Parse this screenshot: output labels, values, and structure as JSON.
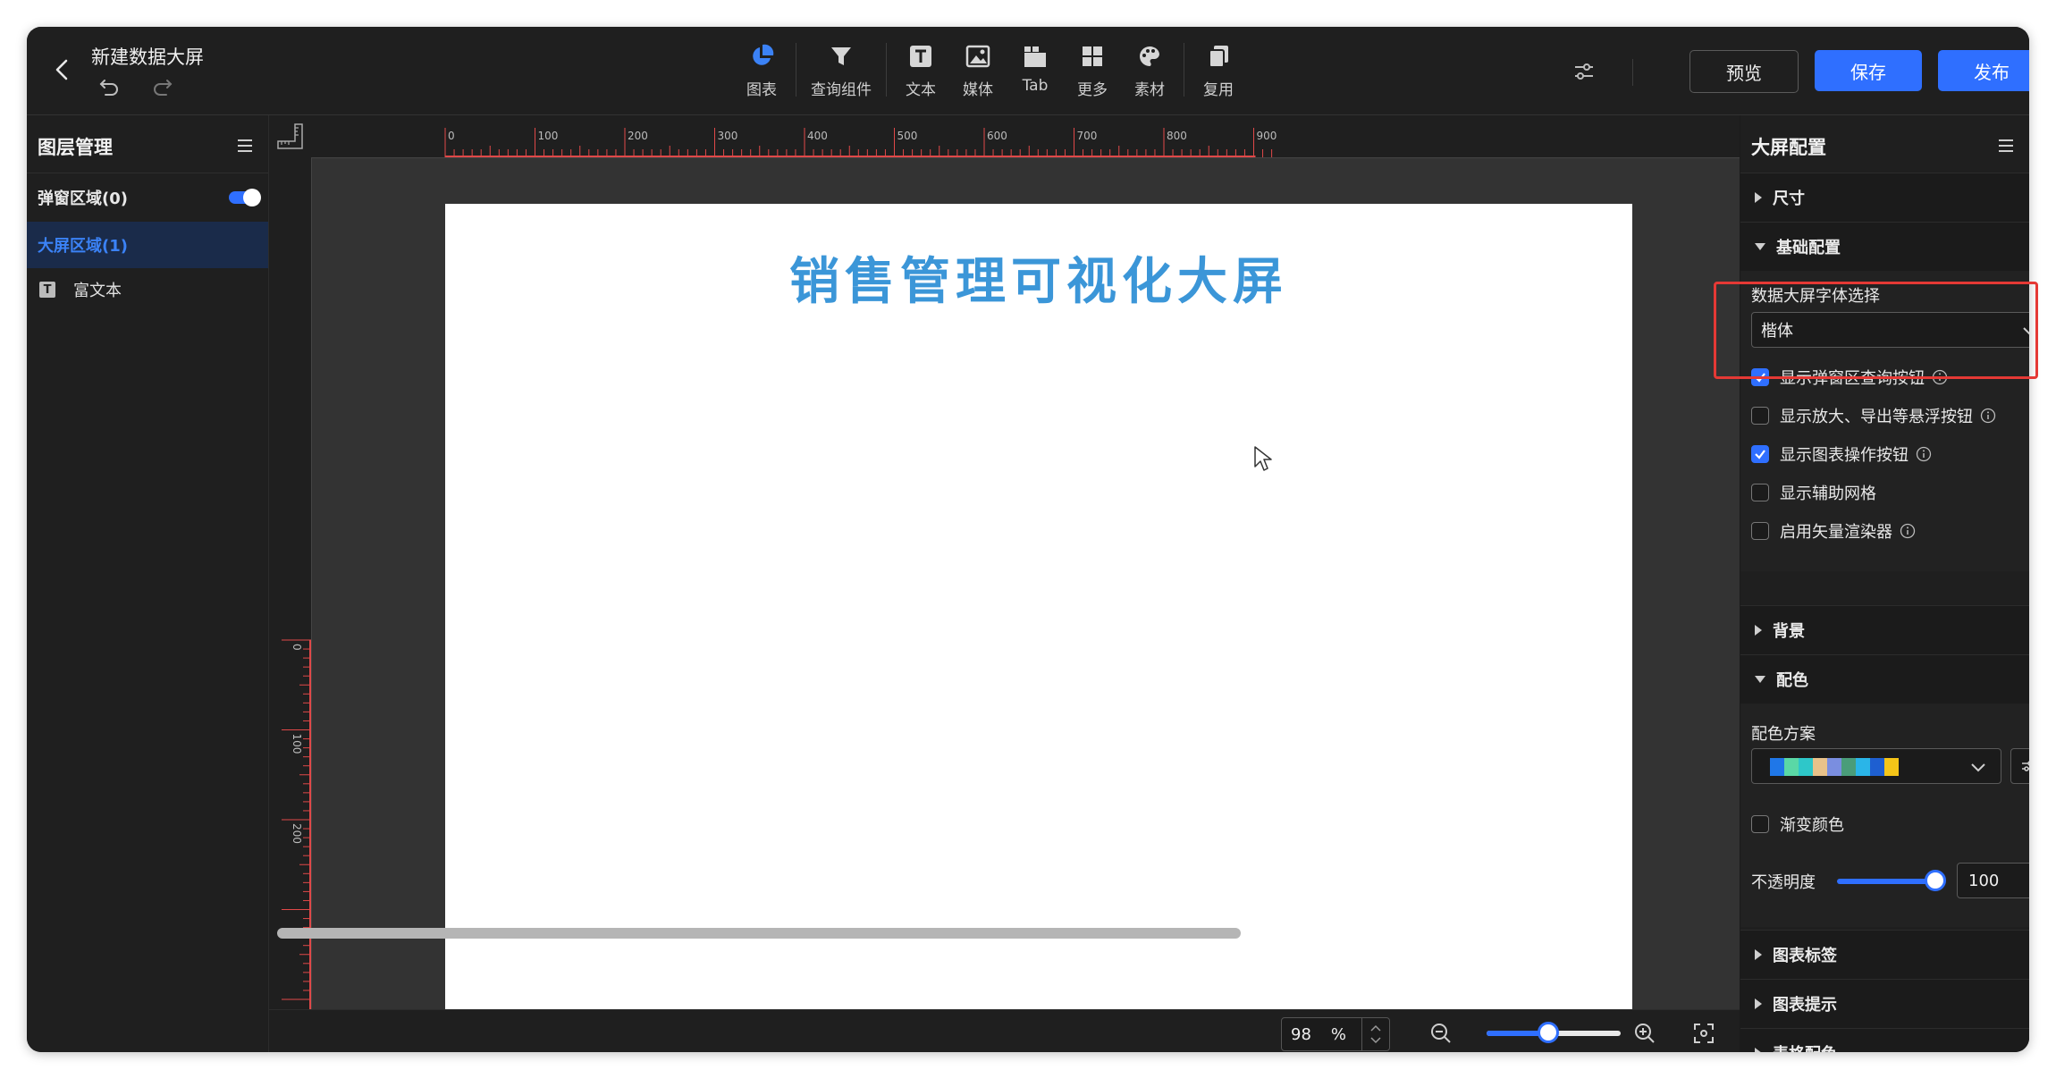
{
  "header": {
    "title": "新建数据大屏",
    "tools": [
      {
        "label": "图表",
        "icon": "pie-chart-icon"
      },
      {
        "label": "查询组件",
        "icon": "funnel-icon"
      },
      {
        "label": "文本",
        "icon": "text-icon"
      },
      {
        "label": "媒体",
        "icon": "image-icon"
      },
      {
        "label": "Tab",
        "icon": "tab-icon"
      },
      {
        "label": "更多",
        "icon": "grid-icon"
      },
      {
        "label": "素材",
        "icon": "palette-icon"
      },
      {
        "label": "复用",
        "icon": "copy-icon"
      }
    ],
    "preview_label": "预览",
    "save_label": "保存",
    "publish_label": "发布"
  },
  "left_panel": {
    "title": "图层管理",
    "popup_area": "弹窗区域(0)",
    "popup_toggle_on": true,
    "screen_area": "大屏区域(1)",
    "layers": [
      "富文本"
    ]
  },
  "canvas": {
    "ruler_h_labels": [
      "0",
      "100",
      "200",
      "300",
      "400",
      "500",
      "600",
      "700",
      "800",
      "900"
    ],
    "ruler_v_labels": [
      "0",
      "100",
      "200"
    ],
    "screen_title": "销售管理可视化大屏",
    "zoom_value": "98",
    "zoom_unit": "%",
    "zoom_slider_fraction": 0.46
  },
  "right_panel": {
    "title": "大屏配置",
    "sections": {
      "size": "尺寸",
      "basic": "基础配置",
      "background": "背景",
      "color": "配色",
      "chart_label": "图表标签",
      "chart_tip": "图表提示",
      "table_color": "表格配色"
    },
    "font_label": "数据大屏字体选择",
    "font_value": "楷体",
    "options": [
      {
        "label": "显示弹窗区查询按钮",
        "checked": true,
        "info": true
      },
      {
        "label": "显示放大、导出等悬浮按钮",
        "checked": false,
        "info": true
      },
      {
        "label": "显示图表操作按钮",
        "checked": true,
        "info": true
      },
      {
        "label": "显示辅助网格",
        "checked": false,
        "info": false
      },
      {
        "label": "启用矢量渲染器",
        "checked": false,
        "info": true
      }
    ],
    "color_scheme_label": "配色方案",
    "swatches": [
      "#1f77e8",
      "#5ad8a6",
      "#2ec7c9",
      "#e8c28a",
      "#7a8ee0",
      "#4a9d7a",
      "#2ab5e8",
      "#1e5fd1",
      "#f5c518"
    ],
    "gradient_label": "渐变颜色",
    "gradient_checked": false,
    "opacity_label": "不透明度",
    "opacity_value": "100",
    "opacity_unit": "%"
  },
  "colors": {
    "accent": "#2f6fff",
    "title_blue": "#3b96d8",
    "highlight_red": "#e53935"
  }
}
